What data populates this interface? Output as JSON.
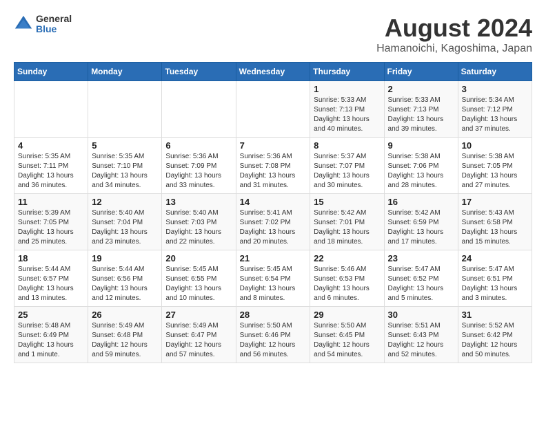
{
  "header": {
    "logo": {
      "general": "General",
      "blue": "Blue"
    },
    "title": "August 2024",
    "location": "Hamanoichi, Kagoshima, Japan"
  },
  "days_header": [
    "Sunday",
    "Monday",
    "Tuesday",
    "Wednesday",
    "Thursday",
    "Friday",
    "Saturday"
  ],
  "weeks": [
    [
      {
        "day": "",
        "info": ""
      },
      {
        "day": "",
        "info": ""
      },
      {
        "day": "",
        "info": ""
      },
      {
        "day": "",
        "info": ""
      },
      {
        "day": "1",
        "info": "Sunrise: 5:33 AM\nSunset: 7:13 PM\nDaylight: 13 hours\nand 40 minutes."
      },
      {
        "day": "2",
        "info": "Sunrise: 5:33 AM\nSunset: 7:13 PM\nDaylight: 13 hours\nand 39 minutes."
      },
      {
        "day": "3",
        "info": "Sunrise: 5:34 AM\nSunset: 7:12 PM\nDaylight: 13 hours\nand 37 minutes."
      }
    ],
    [
      {
        "day": "4",
        "info": "Sunrise: 5:35 AM\nSunset: 7:11 PM\nDaylight: 13 hours\nand 36 minutes."
      },
      {
        "day": "5",
        "info": "Sunrise: 5:35 AM\nSunset: 7:10 PM\nDaylight: 13 hours\nand 34 minutes."
      },
      {
        "day": "6",
        "info": "Sunrise: 5:36 AM\nSunset: 7:09 PM\nDaylight: 13 hours\nand 33 minutes."
      },
      {
        "day": "7",
        "info": "Sunrise: 5:36 AM\nSunset: 7:08 PM\nDaylight: 13 hours\nand 31 minutes."
      },
      {
        "day": "8",
        "info": "Sunrise: 5:37 AM\nSunset: 7:07 PM\nDaylight: 13 hours\nand 30 minutes."
      },
      {
        "day": "9",
        "info": "Sunrise: 5:38 AM\nSunset: 7:06 PM\nDaylight: 13 hours\nand 28 minutes."
      },
      {
        "day": "10",
        "info": "Sunrise: 5:38 AM\nSunset: 7:05 PM\nDaylight: 13 hours\nand 27 minutes."
      }
    ],
    [
      {
        "day": "11",
        "info": "Sunrise: 5:39 AM\nSunset: 7:05 PM\nDaylight: 13 hours\nand 25 minutes."
      },
      {
        "day": "12",
        "info": "Sunrise: 5:40 AM\nSunset: 7:04 PM\nDaylight: 13 hours\nand 23 minutes."
      },
      {
        "day": "13",
        "info": "Sunrise: 5:40 AM\nSunset: 7:03 PM\nDaylight: 13 hours\nand 22 minutes."
      },
      {
        "day": "14",
        "info": "Sunrise: 5:41 AM\nSunset: 7:02 PM\nDaylight: 13 hours\nand 20 minutes."
      },
      {
        "day": "15",
        "info": "Sunrise: 5:42 AM\nSunset: 7:01 PM\nDaylight: 13 hours\nand 18 minutes."
      },
      {
        "day": "16",
        "info": "Sunrise: 5:42 AM\nSunset: 6:59 PM\nDaylight: 13 hours\nand 17 minutes."
      },
      {
        "day": "17",
        "info": "Sunrise: 5:43 AM\nSunset: 6:58 PM\nDaylight: 13 hours\nand 15 minutes."
      }
    ],
    [
      {
        "day": "18",
        "info": "Sunrise: 5:44 AM\nSunset: 6:57 PM\nDaylight: 13 hours\nand 13 minutes."
      },
      {
        "day": "19",
        "info": "Sunrise: 5:44 AM\nSunset: 6:56 PM\nDaylight: 13 hours\nand 12 minutes."
      },
      {
        "day": "20",
        "info": "Sunrise: 5:45 AM\nSunset: 6:55 PM\nDaylight: 13 hours\nand 10 minutes."
      },
      {
        "day": "21",
        "info": "Sunrise: 5:45 AM\nSunset: 6:54 PM\nDaylight: 13 hours\nand 8 minutes."
      },
      {
        "day": "22",
        "info": "Sunrise: 5:46 AM\nSunset: 6:53 PM\nDaylight: 13 hours\nand 6 minutes."
      },
      {
        "day": "23",
        "info": "Sunrise: 5:47 AM\nSunset: 6:52 PM\nDaylight: 13 hours\nand 5 minutes."
      },
      {
        "day": "24",
        "info": "Sunrise: 5:47 AM\nSunset: 6:51 PM\nDaylight: 13 hours\nand 3 minutes."
      }
    ],
    [
      {
        "day": "25",
        "info": "Sunrise: 5:48 AM\nSunset: 6:49 PM\nDaylight: 13 hours\nand 1 minute."
      },
      {
        "day": "26",
        "info": "Sunrise: 5:49 AM\nSunset: 6:48 PM\nDaylight: 12 hours\nand 59 minutes."
      },
      {
        "day": "27",
        "info": "Sunrise: 5:49 AM\nSunset: 6:47 PM\nDaylight: 12 hours\nand 57 minutes."
      },
      {
        "day": "28",
        "info": "Sunrise: 5:50 AM\nSunset: 6:46 PM\nDaylight: 12 hours\nand 56 minutes."
      },
      {
        "day": "29",
        "info": "Sunrise: 5:50 AM\nSunset: 6:45 PM\nDaylight: 12 hours\nand 54 minutes."
      },
      {
        "day": "30",
        "info": "Sunrise: 5:51 AM\nSunset: 6:43 PM\nDaylight: 12 hours\nand 52 minutes."
      },
      {
        "day": "31",
        "info": "Sunrise: 5:52 AM\nSunset: 6:42 PM\nDaylight: 12 hours\nand 50 minutes."
      }
    ]
  ]
}
